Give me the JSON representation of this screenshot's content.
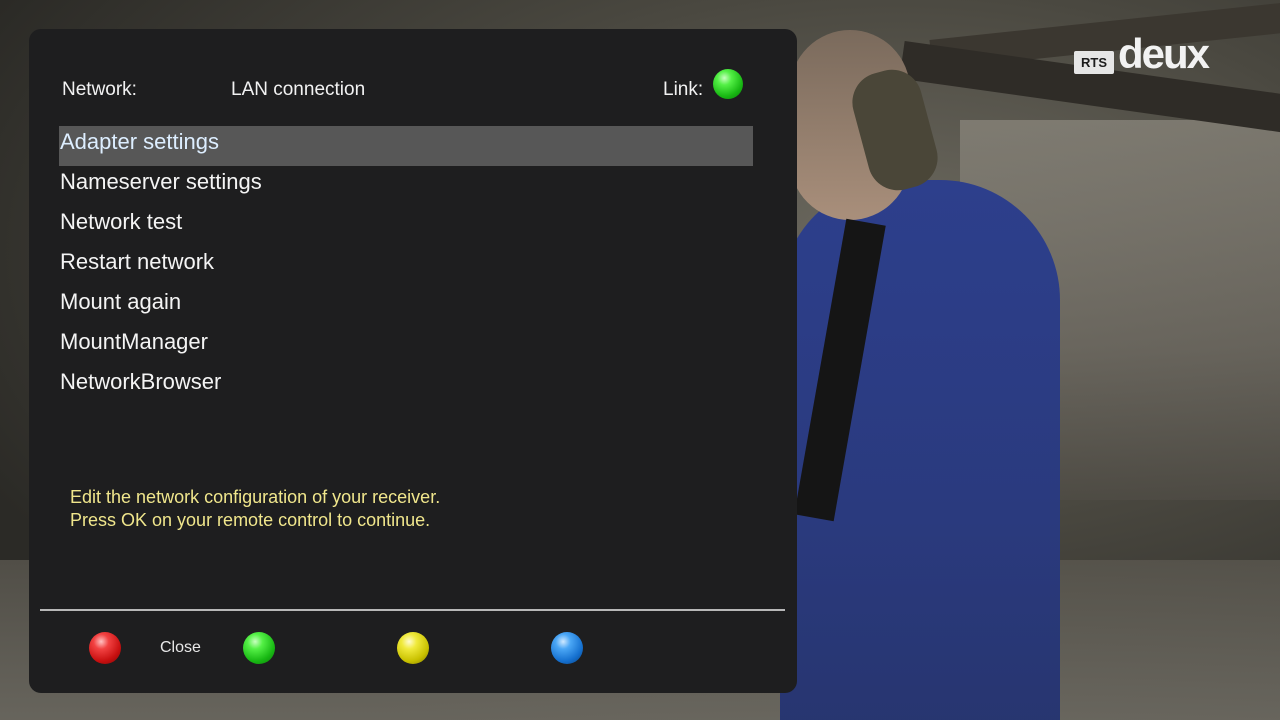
{
  "header": {
    "network_label": "Network:",
    "connection": "LAN connection",
    "link_label": "Link:",
    "link_status_color": "#33cc22"
  },
  "menu": {
    "items": [
      {
        "label": "Adapter settings",
        "selected": true
      },
      {
        "label": "Nameserver settings"
      },
      {
        "label": "Network test"
      },
      {
        "label": "Restart network"
      },
      {
        "label": "Mount again"
      },
      {
        "label": "MountManager"
      },
      {
        "label": "NetworkBrowser"
      }
    ]
  },
  "help": {
    "line1": "Edit the network configuration of your receiver.",
    "line2": "Press OK on your remote control to continue."
  },
  "footer": {
    "red_label": "Close",
    "green_label": "",
    "yellow_label": "",
    "blue_label": ""
  },
  "logo": {
    "small": "RTS",
    "large": "deux"
  },
  "colors": {
    "panel_bg": "#1e1e1f",
    "selection_bg": "#575757",
    "help_text": "#f0e68c"
  }
}
